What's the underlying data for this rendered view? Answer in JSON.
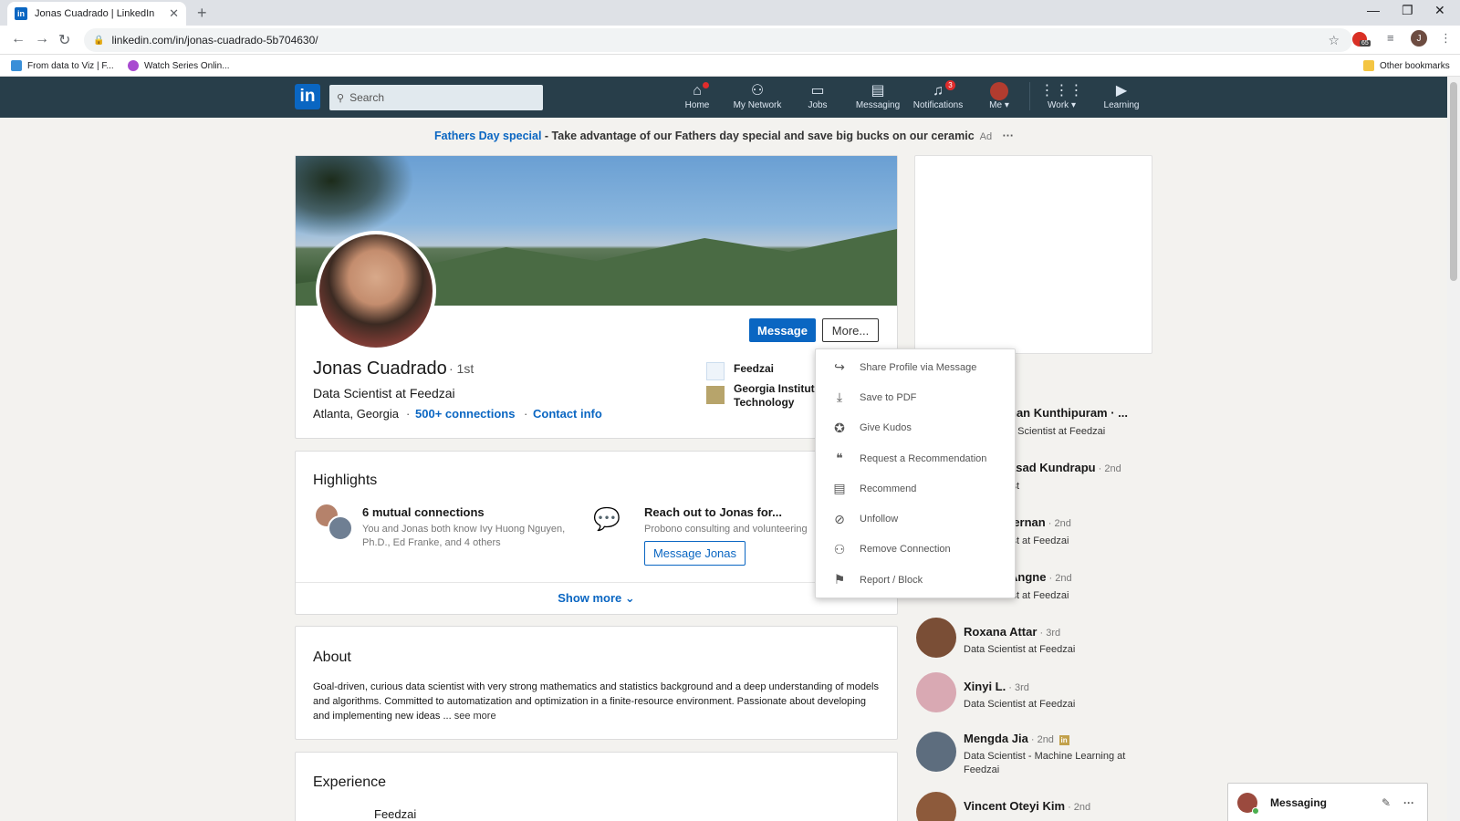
{
  "browser": {
    "tab_title": "Jonas Cuadrado | LinkedIn",
    "tab_icon": "in",
    "url": "linkedin.com/in/jonas-cuadrado-5b704630/",
    "bookmarks": [
      "From data to Viz | F...",
      "Watch Series Onlin..."
    ],
    "other_bookmarks": "Other bookmarks",
    "profile_initial": "J",
    "ext_badge": "65"
  },
  "nav": {
    "logo": "in",
    "search_placeholder": "Search",
    "items": [
      {
        "label": "Home",
        "icon": "home-icon",
        "badge": ""
      },
      {
        "label": "My Network",
        "icon": "network-icon",
        "badge": ""
      },
      {
        "label": "Jobs",
        "icon": "briefcase-icon",
        "badge": ""
      },
      {
        "label": "Messaging",
        "icon": "chat-icon",
        "badge": ""
      },
      {
        "label": "Notifications",
        "icon": "bell-icon",
        "badge": "3"
      },
      {
        "label": "Me",
        "icon": "avatar-icon",
        "badge": ""
      },
      {
        "label": "Work",
        "icon": "grid-icon",
        "badge": ""
      },
      {
        "label": "Learning",
        "icon": "play-icon",
        "badge": ""
      }
    ]
  },
  "ad": {
    "link": "Fathers Day special",
    "text": " - Take advantage of our Fathers day special and save big bucks on our ceramic",
    "tag": "Ad",
    "more": "···"
  },
  "profile": {
    "name": "Jonas Cuadrado",
    "degree": "· 1st",
    "headline": "Data Scientist at Feedzai",
    "location": "Atlanta, Georgia",
    "connections": "500+ connections",
    "contact": "Contact info",
    "message_button": "Message",
    "more_button": "More...",
    "company": "Feedzai",
    "school_line1": "Georgia Institute",
    "school_line2": "Technology"
  },
  "highlights": {
    "title": "Highlights",
    "mutual_title": "6 mutual connections",
    "mutual_sub_1": "You and Jonas both know Ivy Huong Nguyen,",
    "mutual_sub_2": "Ph.D., Ed Franke, and 4 others",
    "reach_title": "Reach out to Jonas for...",
    "reach_sub": "Probono consulting and volunteering",
    "message_jonas": "Message Jonas",
    "show_more": "Show more ⌄"
  },
  "about": {
    "title": "About",
    "text": "Goal-driven, curious data scientist with very strong mathematics and statistics background and a deep understanding of models and algorithms. Committed to automatization and optimization in a finite-resource environment. Passionate about developing and implementing new ideas ...",
    "see_more": " see more"
  },
  "experience": {
    "title": "Experience",
    "first_company": "Feedzai"
  },
  "dropdown": [
    {
      "label": "Share Profile via Message",
      "icon": "share-icon",
      "glyph": "↪"
    },
    {
      "label": "Save to PDF",
      "icon": "download-icon",
      "glyph": "⤓"
    },
    {
      "label": "Give Kudos",
      "icon": "award-icon",
      "glyph": "✪"
    },
    {
      "label": "Request a Recommendation",
      "icon": "quote-icon",
      "glyph": "❝"
    },
    {
      "label": "Recommend",
      "icon": "comment-icon",
      "glyph": "▤"
    },
    {
      "label": "Unfollow",
      "icon": "block-icon",
      "glyph": "⊘"
    },
    {
      "label": "Remove Connection",
      "icon": "remove-user-icon",
      "glyph": "⚇"
    },
    {
      "label": "Report / Block",
      "icon": "flag-icon",
      "glyph": "⚑"
    }
  ],
  "people_also_viewed": {
    "title_tail": "d",
    "people": [
      {
        "name": "han Kunthipuram · ...",
        "degree": "",
        "role": "a Scientist at Feedzai",
        "color": "#ffffff"
      },
      {
        "name": "asad Kundrapu",
        "degree": " · 2nd",
        "role": "ist",
        "color": "#ffffff"
      },
      {
        "name": "fernan",
        "degree": " · 2nd",
        "role": "ist at Feedzai",
        "color": "#ffffff"
      },
      {
        "name": "Angne",
        "degree": " · 2nd",
        "role": "ist at Feedzai",
        "color": "#ffffff"
      },
      {
        "name": "Roxana Attar",
        "degree": " · 3rd",
        "role": "Data Scientist at Feedzai",
        "color": "#7a4e36"
      },
      {
        "name": "Xinyi L.",
        "degree": " · 3rd",
        "role": "Data Scientist at Feedzai",
        "color": "#d9a9b3"
      },
      {
        "name": "Mengda Jia",
        "degree": " · 2nd",
        "role": "Data Scientist - Machine Learning at Feedzai",
        "color": "#5d6d7e"
      },
      {
        "name": "Vincent Oteyi Kim",
        "degree": " · 2nd",
        "role": "",
        "color": "#8d5a3b"
      }
    ]
  },
  "messaging": {
    "label": "Messaging"
  },
  "colors": {
    "linkedin_blue": "#0a66c2",
    "nav_bg": "#283e4a",
    "page_bg": "#f3f2ef"
  }
}
